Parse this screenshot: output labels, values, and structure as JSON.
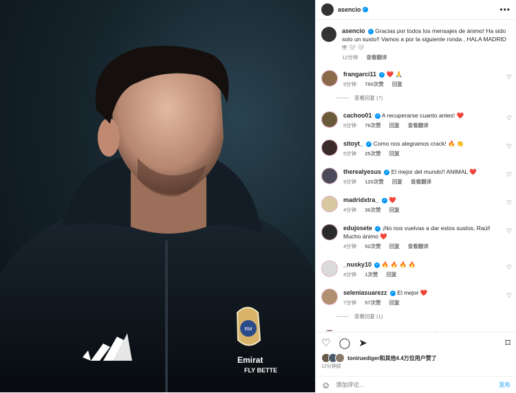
{
  "header": {
    "username": "asencio",
    "more_icon": "ellipsis-icon"
  },
  "caption": {
    "username": "asencio",
    "text": "Gracias por todos los mensajes de ánimo! Ha sido solo un susto!! Vamos a por la siguiente ronda , HALA MADRID !!! 🤍 🤍",
    "time": "12分钟",
    "translate": "查看翻译"
  },
  "comments": [
    {
      "user": "frangarci11",
      "text": "❤️ 🙏",
      "time": "9分钟",
      "likes": "780次赞",
      "reply": "回复",
      "translate": "",
      "view_replies": "查看回复 (7)",
      "avatar_color": "#8a6a4a"
    },
    {
      "user": "cachoo01",
      "text": "A recuperarse cuanto antes! ❤️",
      "time": "5分钟",
      "likes": "76次赞",
      "reply": "回复",
      "translate": "查看翻译",
      "view_replies": "",
      "avatar_color": "#6a5a3a"
    },
    {
      "user": "sitoyt_",
      "text": "Como nos alegramos crack! 🔥 👏",
      "time": "5分钟",
      "likes": "25次赞",
      "reply": "回复",
      "translate": "",
      "view_replies": "",
      "avatar_color": "#3a2a2a"
    },
    {
      "user": "therealyesus",
      "text": "El mejor del mundo!! ANIMAL ❤️",
      "time": "9分钟",
      "likes": "120次赞",
      "reply": "回复",
      "translate": "查看翻译",
      "view_replies": "",
      "avatar_color": "#4a4a5a"
    },
    {
      "user": "madridxtra_",
      "text": "❤️",
      "time": "4分钟",
      "likes": "36次赞",
      "reply": "回复",
      "translate": "",
      "view_replies": "",
      "avatar_color": "#d8c8a0"
    },
    {
      "user": "edujosete",
      "text": "¡No nos vuelvas a dar estos sustos, Raúl! Mucho ánimo ❤️",
      "time": "4分钟",
      "likes": "52次赞",
      "reply": "回复",
      "translate": "查看翻译",
      "view_replies": "",
      "avatar_color": "#2a2a2a"
    },
    {
      "user": "_nusky10",
      "text": "🔥 🔥 🔥 🔥",
      "time": "4分钟",
      "likes": "1次赞",
      "reply": "回复",
      "translate": "",
      "view_replies": "",
      "avatar_color": "#dbdbdb"
    },
    {
      "user": "seleniasuarezz",
      "text": "El mejor ❤️",
      "time": "7分钟",
      "likes": "57次赞",
      "reply": "回复",
      "translate": "",
      "view_replies": "查看回复 (1)",
      "avatar_color": "#b09070"
    },
    {
      "user": "kabeto",
      "text": "Dándolo todo siempre 🔥",
      "time": "",
      "likes": "",
      "reply": "",
      "translate": "",
      "view_replies": "",
      "avatar_color": "#5a4a3a"
    }
  ],
  "actions": {
    "like": "heart-icon",
    "comment": "comment-icon",
    "share": "share-icon",
    "save": "bookmark-icon"
  },
  "likes_summary": {
    "user": "toniruediger",
    "rest": "和其他4.4万位用户赞了"
  },
  "post_time": "12分钟前",
  "comment_input": {
    "placeholder": "添加评论...",
    "post": "发布"
  },
  "colors": {
    "accent": "#0095f6",
    "verified": "#0095f6",
    "muted": "#737373"
  }
}
